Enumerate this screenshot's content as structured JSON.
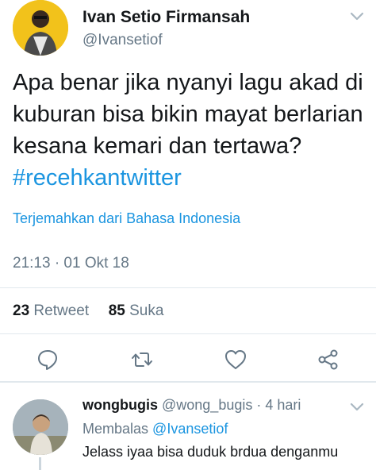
{
  "tweet": {
    "author_name": "Ivan Setio Firmansah",
    "author_handle": "@Ivansetiof",
    "text": "Apa benar jika nyanyi lagu akad di kuburan bisa bikin mayat berlarian kesana kemari dan tertawa?",
    "hashtag": "#recehkantwitter",
    "translate_label": "Terjemahkan dari Bahasa Indonesia",
    "timestamp": "21:13 · 01 Okt 18",
    "retweet_count": "23",
    "retweet_label": "Retweet",
    "like_count": "85",
    "like_label": "Suka"
  },
  "actions": {
    "icons": [
      "reply-icon",
      "retweet-icon",
      "like-icon",
      "share-icon"
    ]
  },
  "reply": {
    "author_name": "wongbugis",
    "author_handle": "@wong_bugis",
    "time": "· 4 hari",
    "replying_prefix": "Membalas",
    "replying_to": "@Ivansetiof",
    "text": "Jelass iyaa bisa duduk brdua denganmu"
  },
  "colors": {
    "accent": "#1b95e0",
    "secondary_text": "#657786",
    "primary_text": "#14171a",
    "divider": "#e1e8ed"
  }
}
